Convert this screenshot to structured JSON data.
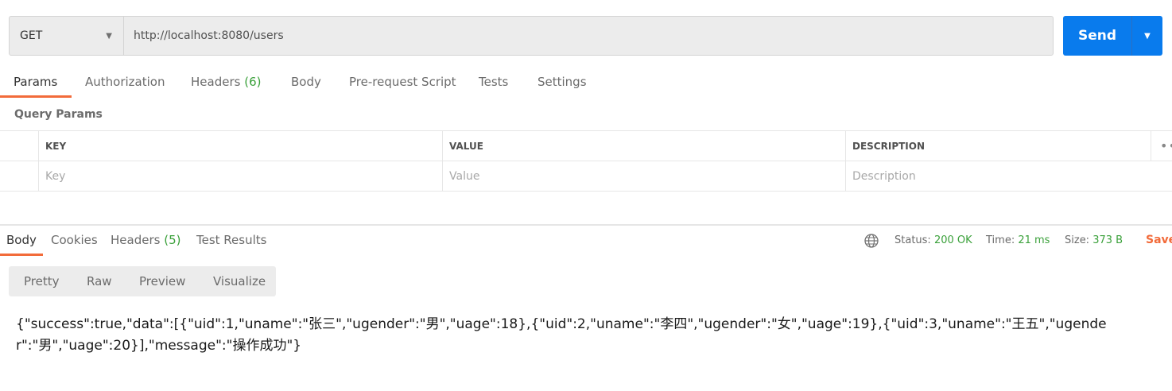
{
  "request": {
    "method": "GET",
    "url": "http://localhost:8080/users",
    "send_label": "Send",
    "tabs": [
      {
        "label": "Params",
        "count": ""
      },
      {
        "label": "Authorization",
        "count": ""
      },
      {
        "label": "Headers",
        "count": "(6)"
      },
      {
        "label": "Body",
        "count": ""
      },
      {
        "label": "Pre-request Script",
        "count": ""
      },
      {
        "label": "Tests",
        "count": ""
      },
      {
        "label": "Settings",
        "count": ""
      }
    ]
  },
  "params": {
    "section_label": "Query Params",
    "columns": [
      "KEY",
      "VALUE",
      "DESCRIPTION"
    ],
    "placeholders": {
      "key": "Key",
      "value": "Value",
      "description": "Description"
    }
  },
  "response": {
    "tabs": [
      {
        "label": "Body",
        "count": ""
      },
      {
        "label": "Cookies",
        "count": ""
      },
      {
        "label": "Headers",
        "count": "(5)"
      },
      {
        "label": "Test Results",
        "count": ""
      }
    ],
    "status_label": "Status:",
    "status_value": "200 OK",
    "time_label": "Time:",
    "time_value": "21 ms",
    "size_label": "Size:",
    "size_value": "373 B",
    "save_label": "Save",
    "views": [
      "Pretty",
      "Raw",
      "Preview",
      "Visualize"
    ],
    "body_text": "{\"success\":true,\"data\":[{\"uid\":1,\"uname\":\"张三\",\"ugender\":\"男\",\"uage\":18},{\"uid\":2,\"uname\":\"李四\",\"ugender\":\"女\",\"uage\":19},{\"uid\":3,\"uname\":\"王五\",\"ugender\":\"男\",\"uage\":20}],\"message\":\"操作成功\"}"
  },
  "colors": {
    "accent": "#f26b3a",
    "send": "#097bed",
    "success": "#3ba13b"
  },
  "icons": {
    "method_dropdown": "chevron-down-icon",
    "send_dropdown": "chevron-down-icon",
    "response_globe": "globe-icon",
    "more": "more-horizontal-icon"
  }
}
